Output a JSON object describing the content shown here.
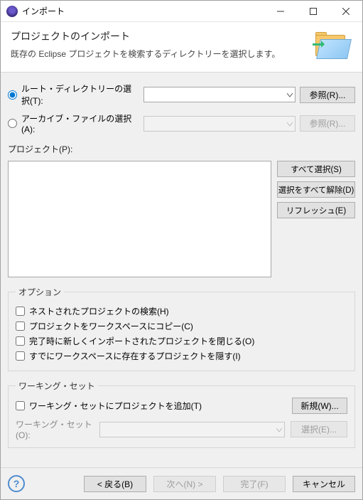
{
  "window": {
    "title": "インポート"
  },
  "header": {
    "title": "プロジェクトのインポート",
    "description": "既存の Eclipse プロジェクトを検索するディレクトリーを選択します。"
  },
  "source": {
    "root_radio_label": "ルート・ディレクトリーの選択(T):",
    "root_value": "",
    "root_browse": "参照(R)...",
    "archive_radio_label": "アーカイブ・ファイルの選択(A):",
    "archive_value": "",
    "archive_browse": "参照(R)..."
  },
  "projects": {
    "label": "プロジェクト(P):",
    "select_all": "すべて選択(S)",
    "deselect_all": "選択をすべて解除(D)",
    "refresh": "リフレッシュ(E)"
  },
  "options": {
    "legend": "オプション",
    "nested": "ネストされたプロジェクトの検索(H)",
    "copy": "プロジェクトをワークスペースにコピー(C)",
    "close": "完了時に新しくインポートされたプロジェクトを閉じる(O)",
    "hide": "すでにワークスペースに存在するプロジェクトを隠す(I)"
  },
  "working_sets": {
    "legend": "ワーキング・セット",
    "add_label": "ワーキング・セットにプロジェクトを追加(T)",
    "new_btn": "新規(W)...",
    "combo_label": "ワーキング・セット(O):",
    "combo_value": "",
    "select_btn": "選択(E)..."
  },
  "footer": {
    "back": "< 戻る(B)",
    "next": "次へ(N) >",
    "finish": "完了(F)",
    "cancel": "キャンセル"
  }
}
